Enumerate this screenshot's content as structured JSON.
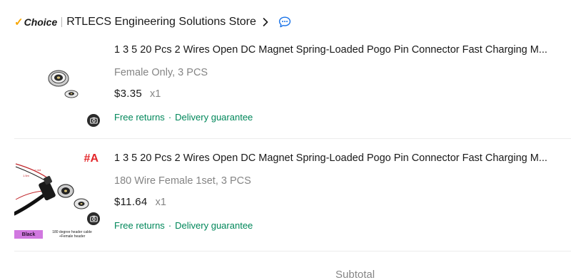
{
  "store": {
    "choice_label": "Choice",
    "name": "RTLECS Engineering Solutions Store"
  },
  "items": [
    {
      "title": "1 3 5 20 Pcs 2 Wires Open DC Magnet Spring-Loaded Pogo Pin Connector Fast Charging M...",
      "variant": "Female Only, 3 PCS",
      "price": "$3.35",
      "quantity": "x1",
      "service_free_returns": "Free returns",
      "service_separator": "·",
      "service_delivery": "Delivery guarantee"
    },
    {
      "title": "1 3 5 20 Pcs 2 Wires Open DC Magnet Spring-Loaded Pogo Pin Connector Fast Charging M...",
      "variant": "180 Wire Female 1set, 3 PCS",
      "price": "$11.64",
      "quantity": "x1",
      "service_free_returns": "Free returns",
      "service_separator": "·",
      "service_delivery": "Delivery guarantee",
      "image_label": "#A",
      "image_color": "Black",
      "image_caption": "180 degree header cable +Female header"
    }
  ],
  "summary": {
    "subtotal_label": "Subtotal"
  },
  "colors": {
    "choice_check": "#f7a600",
    "service_green": "#00875a",
    "muted_gray": "#858585",
    "chat_blue": "#1a73e8"
  }
}
